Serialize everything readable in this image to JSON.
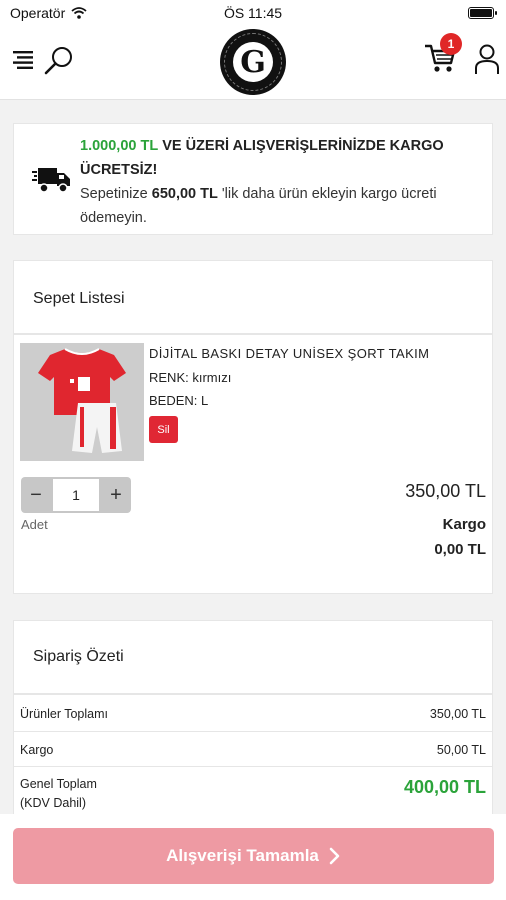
{
  "status_bar": {
    "carrier": "Operatör",
    "time": "ÖS 11:45"
  },
  "header": {
    "logo_letter": "G",
    "cart_count": "1"
  },
  "shipping_notice": {
    "threshold": "1.000,00 TL",
    "headline": "VE ÜZERİ ALIŞVERİŞLERİNİZDE KARGO ÜCRETSİZ!",
    "prefix": "Sepetinize",
    "remaining": "650,00 TL",
    "suffix": "'lik daha ürün ekleyin kargo ücreti ödemeyin."
  },
  "cart": {
    "title": "Sepet Listesi",
    "item": {
      "name": "DİJİTAL BASKI DETAY UNİSEX ŞORT TAKIM",
      "color": "RENK: kırmızı",
      "size": "BEDEN: L",
      "delete_label": "Sil",
      "quantity": "1",
      "quantity_label": "Adet",
      "price": "350,00 TL",
      "shipping_label": "Kargo",
      "shipping_value": "0,00 TL"
    }
  },
  "summary": {
    "title": "Sipariş Özeti",
    "products_label": "Ürünler Toplamı",
    "products_value": "350,00 TL",
    "shipping_label": "Kargo",
    "shipping_value": "50,00 TL",
    "total_label_line1": "Genel Toplam",
    "total_label_line2": "(KDV Dahil)",
    "total_value": "400,00 TL"
  },
  "checkout": {
    "label": "Alışverişi Tamamla"
  },
  "colors": {
    "accent_green": "#2ba33a",
    "badge_red": "#e02727",
    "checkout_pink": "#ee9aa3",
    "delete_red": "#e02734"
  },
  "icons": [
    "wifi-icon",
    "battery-icon",
    "menu-icon",
    "search-icon",
    "cart-icon",
    "user-icon",
    "truck-icon",
    "chevron-right-icon"
  ]
}
